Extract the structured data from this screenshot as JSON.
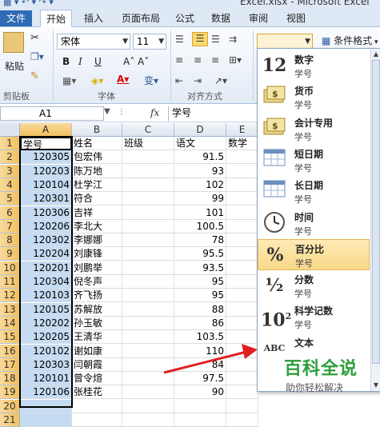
{
  "window": {
    "title": "Excel.xlsx - Microsoft Excel"
  },
  "tabs": [
    "文件",
    "开始",
    "插入",
    "页面布局",
    "公式",
    "数据",
    "审阅",
    "视图"
  ],
  "active_tab": "开始",
  "ribbon": {
    "clipboard": {
      "paste_label": "粘贴",
      "group_label": "剪贴板"
    },
    "font": {
      "font_name": "宋体",
      "font_size": "11",
      "group_label": "字体",
      "bold": "B",
      "italic": "I",
      "underline": "U"
    },
    "alignment": {
      "group_label": "对齐方式"
    },
    "number": {
      "format_value": ""
    },
    "styles": {
      "conditional_format_label": "条件格式"
    }
  },
  "formula_bar": {
    "name_box": "A1",
    "fx": "fx",
    "content": "学号"
  },
  "sheet": {
    "columns": [
      "A",
      "B",
      "C",
      "D",
      "E"
    ],
    "rows": [
      [
        "学号",
        "姓名",
        "班级",
        "语文",
        "数学"
      ],
      [
        "120305",
        "包宏伟",
        "",
        "91.5",
        ""
      ],
      [
        "120203",
        "陈万地",
        "",
        "93",
        ""
      ],
      [
        "120104",
        "杜学江",
        "",
        "102",
        ""
      ],
      [
        "120301",
        "符合",
        "",
        "99",
        ""
      ],
      [
        "120306",
        "吉祥",
        "",
        "101",
        ""
      ],
      [
        "120206",
        "李北大",
        "",
        "100.5",
        ""
      ],
      [
        "120302",
        "李娜娜",
        "",
        "78",
        ""
      ],
      [
        "120204",
        "刘康锋",
        "",
        "95.5",
        ""
      ],
      [
        "120201",
        "刘鹏举",
        "",
        "93.5",
        ""
      ],
      [
        "120304",
        "倪冬声",
        "",
        "95",
        ""
      ],
      [
        "120103",
        "齐飞扬",
        "",
        "95",
        ""
      ],
      [
        "120105",
        "苏解放",
        "",
        "88",
        ""
      ],
      [
        "120202",
        "孙玉敏",
        "",
        "86",
        ""
      ],
      [
        "120205",
        "王清华",
        "",
        "103.5",
        ""
      ],
      [
        "120102",
        "谢如康",
        "",
        "110",
        ""
      ],
      [
        "120303",
        "闫朝霞",
        "",
        "84",
        ""
      ],
      [
        "120101",
        "曾令煊",
        "",
        "97.5",
        ""
      ],
      [
        "120106",
        "张桂花",
        "",
        "90",
        ""
      ],
      [
        "",
        "",
        "",
        "",
        ""
      ],
      [
        "",
        "",
        "",
        "",
        ""
      ]
    ]
  },
  "format_menu": {
    "items": [
      {
        "icon": "12",
        "name": "数字",
        "sample": "学号"
      },
      {
        "icon": "$",
        "name": "货币",
        "sample": "学号"
      },
      {
        "icon": "$",
        "name": "会计专用",
        "sample": "学号"
      },
      {
        "icon": "cal",
        "name": "短日期",
        "sample": "学号"
      },
      {
        "icon": "cal",
        "name": "长日期",
        "sample": "学号"
      },
      {
        "icon": "clock",
        "name": "时间",
        "sample": "学号"
      },
      {
        "icon": "%",
        "name": "百分比",
        "sample": "学号"
      },
      {
        "icon": "½",
        "name": "分数",
        "sample": "学号"
      },
      {
        "icon": "10²",
        "name": "科学记数",
        "sample": "学号"
      },
      {
        "icon": "ABC",
        "name": "文本",
        "sample": ""
      }
    ],
    "highlighted": "百分比"
  },
  "watermark": {
    "title": "百科全说",
    "subtitle": "助你轻松解决"
  },
  "colors": {
    "selection_fill": "#c5dbf2",
    "header_selected": "#f1c15f",
    "watermark": "#2e9e3a",
    "arrow": "#e02020"
  }
}
